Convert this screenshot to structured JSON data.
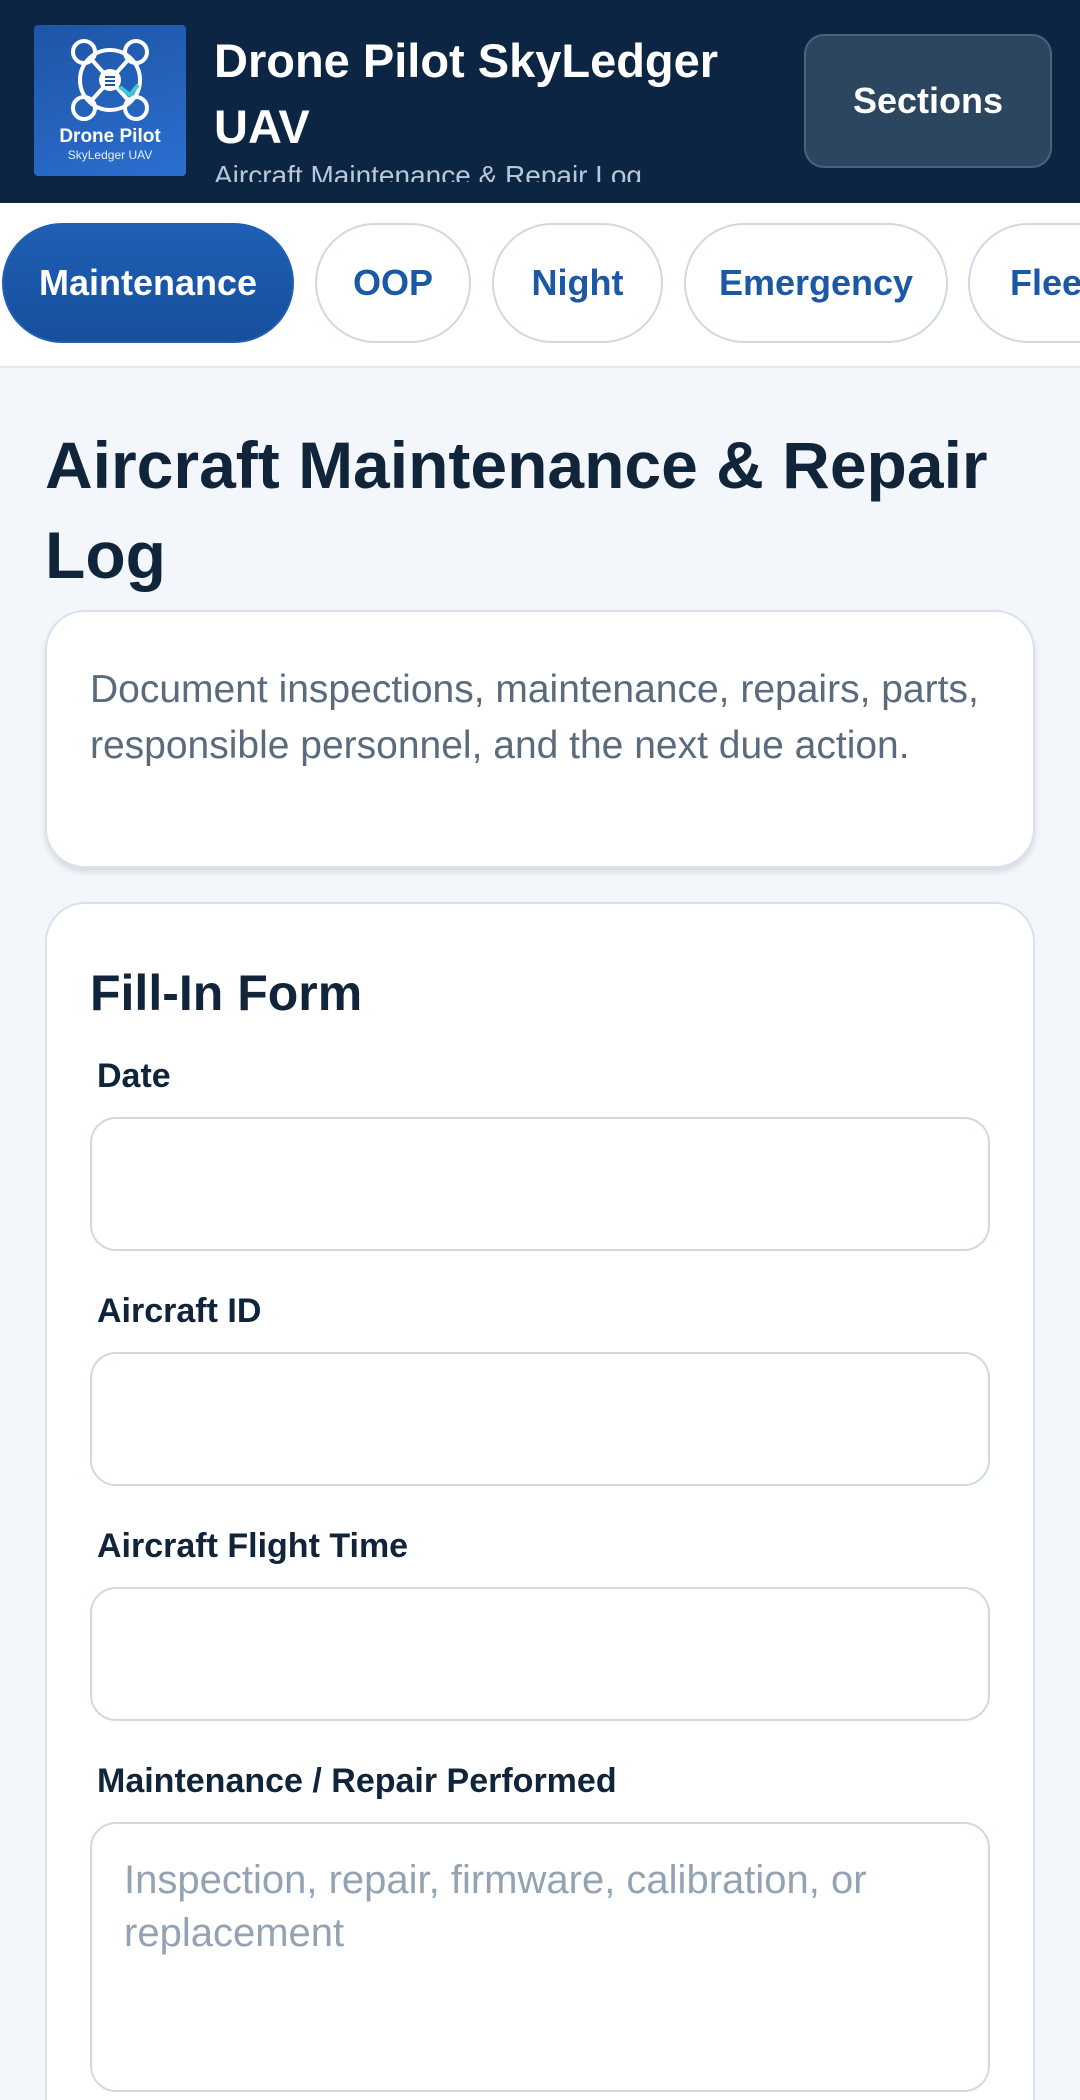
{
  "header": {
    "logo": {
      "title": "Drone Pilot",
      "subtitle": "SkyLedger UAV",
      "icon": "drone-icon"
    },
    "app_title": "Drone Pilot SkyLedger UAV",
    "app_subtitle": "Aircraft Maintenance & Repair Log",
    "sections_label": "Sections"
  },
  "tabs": [
    {
      "label": "Maintenance",
      "active": true
    },
    {
      "label": "OOP",
      "active": false
    },
    {
      "label": "Night",
      "active": false
    },
    {
      "label": "Emergency",
      "active": false
    },
    {
      "label": "Fleet",
      "active": false
    }
  ],
  "main": {
    "page_title": "Aircraft Maintenance & Repair Log",
    "description": "Document inspections, maintenance, repairs, parts, responsible personnel, and the next due action."
  },
  "form": {
    "title": "Fill-In Form",
    "fields": [
      {
        "label": "Date",
        "value": "",
        "placeholder": ""
      },
      {
        "label": "Aircraft ID",
        "value": "",
        "placeholder": ""
      },
      {
        "label": "Aircraft Flight Time",
        "value": "",
        "placeholder": ""
      },
      {
        "label": "Maintenance / Repair Performed",
        "value": "",
        "placeholder": "Inspection, repair, firmware, calibration, or replacement"
      }
    ]
  },
  "colors": {
    "header_bg": "#0c2542",
    "accent": "#1b58a6",
    "page_bg": "#f3f6fa"
  }
}
